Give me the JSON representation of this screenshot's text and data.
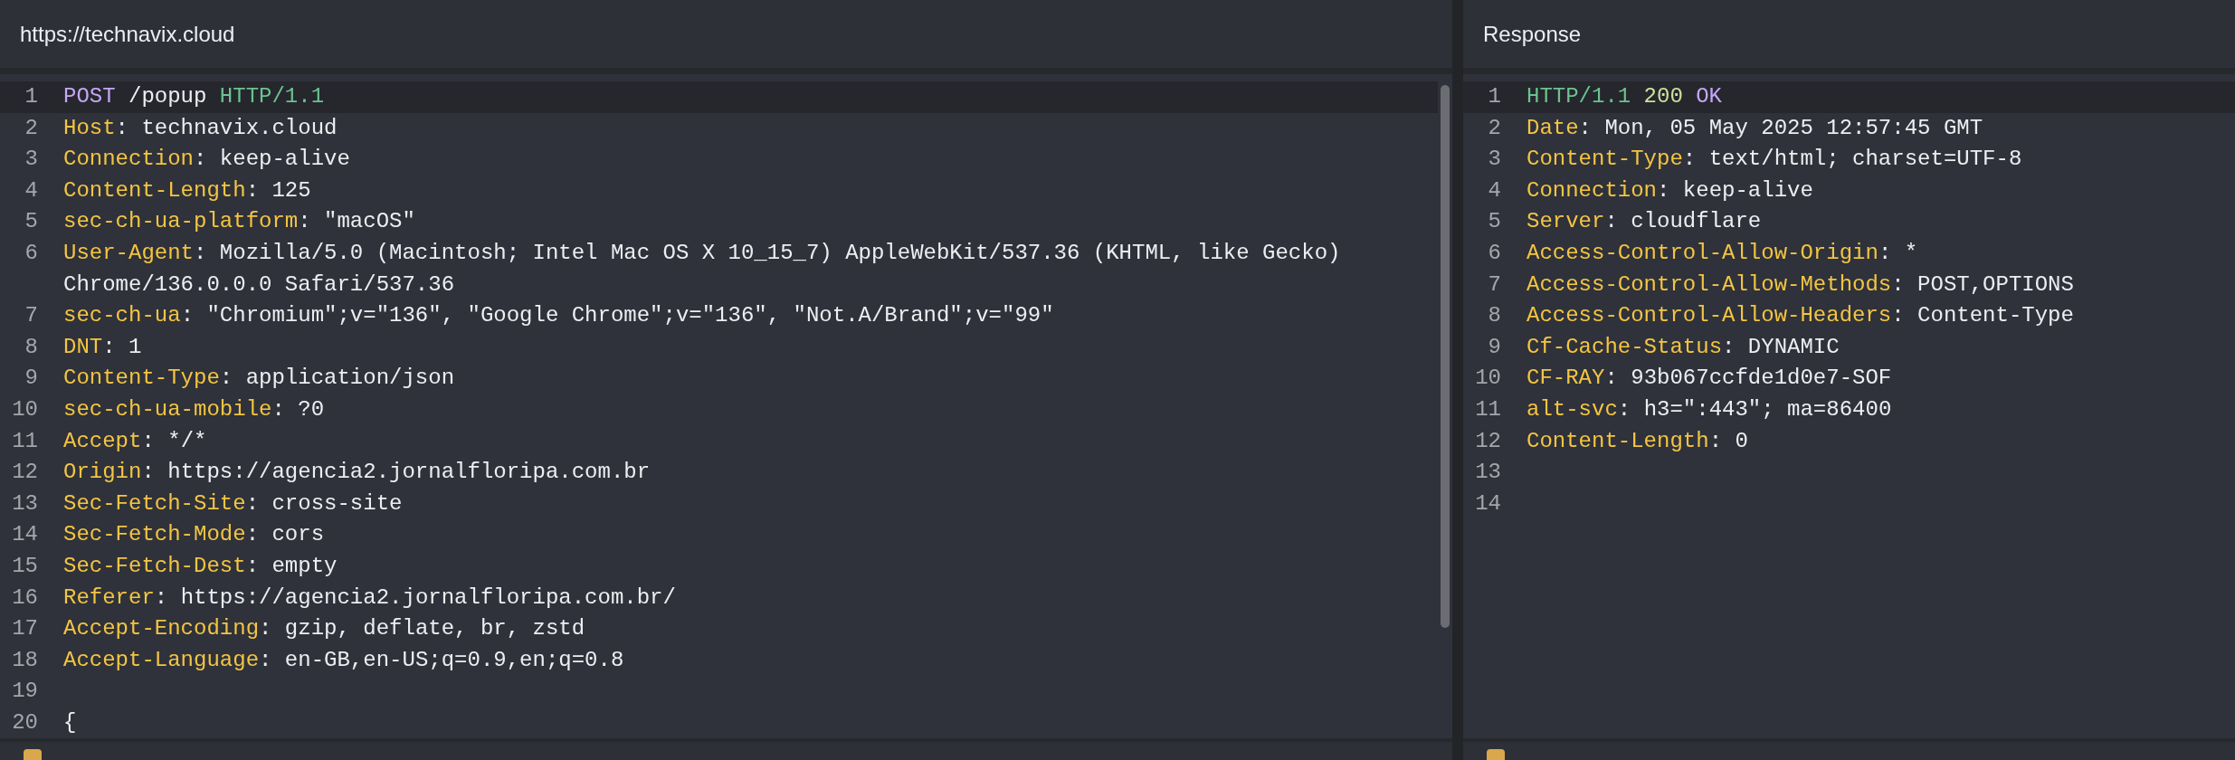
{
  "panels": [
    {
      "title": "https://technavix.cloud",
      "scrollbar": true,
      "lines": [
        {
          "number": "1",
          "current": true,
          "tokens": [
            {
              "kind": "method",
              "text": "POST"
            },
            {
              "kind": "plain",
              "text": " /popup "
            },
            {
              "kind": "version",
              "text": "HTTP/1.1"
            }
          ]
        },
        {
          "number": "2",
          "current": false,
          "tokens": [
            {
              "kind": "key",
              "text": "Host"
            },
            {
              "kind": "plain",
              "text": ": technavix.cloud"
            }
          ]
        },
        {
          "number": "3",
          "current": false,
          "tokens": [
            {
              "kind": "key",
              "text": "Connection"
            },
            {
              "kind": "plain",
              "text": ": keep-alive"
            }
          ]
        },
        {
          "number": "4",
          "current": false,
          "tokens": [
            {
              "kind": "key",
              "text": "Content-Length"
            },
            {
              "kind": "plain",
              "text": ": 125"
            }
          ]
        },
        {
          "number": "5",
          "current": false,
          "tokens": [
            {
              "kind": "key",
              "text": "sec-ch-ua-platform"
            },
            {
              "kind": "plain",
              "text": ": \"macOS\""
            }
          ]
        },
        {
          "number": "6",
          "current": false,
          "tokens": [
            {
              "kind": "key",
              "text": "User-Agent"
            },
            {
              "kind": "plain",
              "text": ": Mozilla/5.0 (Macintosh; Intel Mac OS X 10_15_7) AppleWebKit/537.36 (KHTML, like Gecko) Chrome/136.0.0.0 Safari/537.36"
            }
          ]
        },
        {
          "number": "7",
          "current": false,
          "tokens": [
            {
              "kind": "key",
              "text": "sec-ch-ua"
            },
            {
              "kind": "plain",
              "text": ": \"Chromium\";v=\"136\", \"Google Chrome\";v=\"136\", \"Not.A/Brand\";v=\"99\""
            }
          ]
        },
        {
          "number": "8",
          "current": false,
          "tokens": [
            {
              "kind": "key",
              "text": "DNT"
            },
            {
              "kind": "plain",
              "text": ": 1"
            }
          ]
        },
        {
          "number": "9",
          "current": false,
          "tokens": [
            {
              "kind": "key",
              "text": "Content-Type"
            },
            {
              "kind": "plain",
              "text": ": application/json"
            }
          ]
        },
        {
          "number": "10",
          "current": false,
          "tokens": [
            {
              "kind": "key",
              "text": "sec-ch-ua-mobile"
            },
            {
              "kind": "plain",
              "text": ": ?0"
            }
          ]
        },
        {
          "number": "11",
          "current": false,
          "tokens": [
            {
              "kind": "key",
              "text": "Accept"
            },
            {
              "kind": "plain",
              "text": ": */*"
            }
          ]
        },
        {
          "number": "12",
          "current": false,
          "tokens": [
            {
              "kind": "key",
              "text": "Origin"
            },
            {
              "kind": "plain",
              "text": ": https://agencia2.jornalfloripa.com.br"
            }
          ]
        },
        {
          "number": "13",
          "current": false,
          "tokens": [
            {
              "kind": "key",
              "text": "Sec-Fetch-Site"
            },
            {
              "kind": "plain",
              "text": ": cross-site"
            }
          ]
        },
        {
          "number": "14",
          "current": false,
          "tokens": [
            {
              "kind": "key",
              "text": "Sec-Fetch-Mode"
            },
            {
              "kind": "plain",
              "text": ": cors"
            }
          ]
        },
        {
          "number": "15",
          "current": false,
          "tokens": [
            {
              "kind": "key",
              "text": "Sec-Fetch-Dest"
            },
            {
              "kind": "plain",
              "text": ": empty"
            }
          ]
        },
        {
          "number": "16",
          "current": false,
          "tokens": [
            {
              "kind": "key",
              "text": "Referer"
            },
            {
              "kind": "plain",
              "text": ": https://agencia2.jornalfloripa.com.br/"
            }
          ]
        },
        {
          "number": "17",
          "current": false,
          "tokens": [
            {
              "kind": "key",
              "text": "Accept-Encoding"
            },
            {
              "kind": "plain",
              "text": ": gzip, deflate, br, zstd"
            }
          ]
        },
        {
          "number": "18",
          "current": false,
          "tokens": [
            {
              "kind": "key",
              "text": "Accept-Language"
            },
            {
              "kind": "plain",
              "text": ": en-GB,en-US;q=0.9,en;q=0.8"
            }
          ]
        },
        {
          "number": "19",
          "current": false
        },
        {
          "number": "20",
          "current": false,
          "tokens": [
            {
              "kind": "plain",
              "text": "{"
            }
          ]
        }
      ]
    },
    {
      "title": "Response",
      "scrollbar": false,
      "lines": [
        {
          "number": "1",
          "current": true,
          "tokens": [
            {
              "kind": "version",
              "text": "HTTP/1.1"
            },
            {
              "kind": "status",
              "text": "200"
            },
            {
              "kind": "reason",
              "text": "OK"
            }
          ]
        },
        {
          "number": "2",
          "current": false,
          "tokens": [
            {
              "kind": "key",
              "text": "Date"
            },
            {
              "kind": "plain",
              "text": ": Mon, 05 May 2025 12:57:45 GMT"
            }
          ]
        },
        {
          "number": "3",
          "current": false,
          "tokens": [
            {
              "kind": "key",
              "text": "Content-Type"
            },
            {
              "kind": "plain",
              "text": ": text/html; charset=UTF-8"
            }
          ]
        },
        {
          "number": "4",
          "current": false,
          "tokens": [
            {
              "kind": "key",
              "text": "Connection"
            },
            {
              "kind": "plain",
              "text": ": keep-alive"
            }
          ]
        },
        {
          "number": "5",
          "current": false,
          "tokens": [
            {
              "kind": "key",
              "text": "Server"
            },
            {
              "kind": "plain",
              "text": ": cloudflare"
            }
          ]
        },
        {
          "number": "6",
          "current": false,
          "tokens": [
            {
              "kind": "key",
              "text": "Access-Control-Allow-Origin"
            },
            {
              "kind": "plain",
              "text": ": *"
            }
          ]
        },
        {
          "number": "7",
          "current": false,
          "tokens": [
            {
              "kind": "key",
              "text": "Access-Control-Allow-Methods"
            },
            {
              "kind": "plain",
              "text": ": POST,OPTIONS"
            }
          ]
        },
        {
          "number": "8",
          "current": false,
          "tokens": [
            {
              "kind": "key",
              "text": "Access-Control-Allow-Headers"
            },
            {
              "kind": "plain",
              "text": ": Content-Type"
            }
          ]
        },
        {
          "number": "9",
          "current": false,
          "tokens": [
            {
              "kind": "key",
              "text": "Cf-Cache-Status"
            },
            {
              "kind": "plain",
              "text": ": DYNAMIC"
            }
          ]
        },
        {
          "number": "10",
          "current": false,
          "tokens": [
            {
              "kind": "key",
              "text": "CF-RAY"
            },
            {
              "kind": "plain",
              "text": ": 93b067ccfde1d0e7-SOF"
            }
          ]
        },
        {
          "number": "11",
          "current": false,
          "tokens": [
            {
              "kind": "key",
              "text": "alt-svc"
            },
            {
              "kind": "plain",
              "text": ": h3=\":443\"; ma=86400"
            }
          ]
        },
        {
          "number": "12",
          "current": false,
          "tokens": [
            {
              "kind": "key",
              "text": "Content-Length"
            },
            {
              "kind": "plain",
              "text": ": 0"
            }
          ]
        },
        {
          "number": "13",
          "current": false
        },
        {
          "number": "14",
          "current": false
        }
      ]
    }
  ]
}
